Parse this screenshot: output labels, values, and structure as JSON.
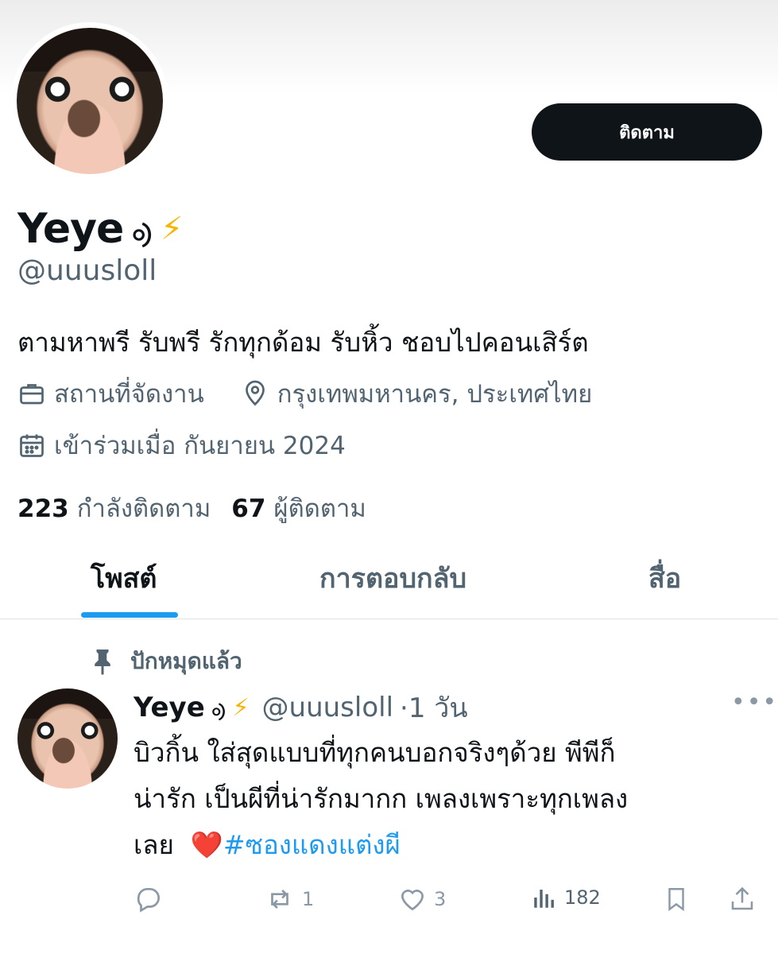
{
  "profile": {
    "display_name": "Yeye",
    "name_glyph": "ᢀ",
    "name_emoji": "⚡",
    "handle": "@uuusloll",
    "bio": "ตามหาพรี รับพรี รักทุกด้อม รับหิ้ว ชอบไปคอนเสิร์ต",
    "work": "สถานที่จัดงาน",
    "location": "กรุงเทพมหานคร, ประเทศไทย",
    "joined": "เข้าร่วมเมื่อ กันยายน 2024",
    "following_count": "223",
    "following_label": "กำลังติดตาม",
    "followers_count": "67",
    "followers_label": "ผู้ติดตาม"
  },
  "follow_button": {
    "label": "ติดตาม"
  },
  "tabs": [
    {
      "label": "โพสต์",
      "active": true
    },
    {
      "label": "การตอบกลับ",
      "active": false
    },
    {
      "label": "สื่อ",
      "active": false
    }
  ],
  "post": {
    "pinned_label": "ปักหมุดแล้ว",
    "author_name": "Yeye",
    "author_glyph": "ᢀ",
    "author_emoji": "⚡",
    "author_handle": "@uuusloll",
    "time": "·1 วัน",
    "text_line1": "บิวกิ้น ใส่สุดแบบที่ทุกคนบอกจริงๆด้วย พีพีก็",
    "text_line2": "น่ารัก เป็นผีที่น่ารักมากก เพลงเพราะทุกเพลง",
    "text_line3": "เลย",
    "heart": "❤️",
    "hashtag": "#ซองแดงแต่งผี",
    "replies": "",
    "reposts": "1",
    "likes": "3",
    "views": "182"
  },
  "colors": {
    "text_primary": "#0f1419",
    "text_secondary": "#536471",
    "accent": "#1d9bf0",
    "bolt": "#f7b500",
    "heart": "#e0245e"
  }
}
